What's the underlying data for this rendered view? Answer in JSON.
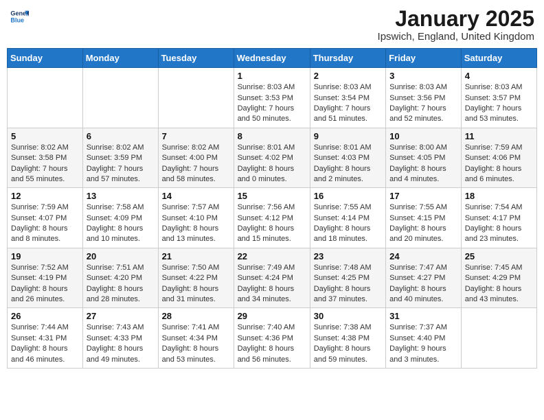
{
  "header": {
    "logo_line1": "General",
    "logo_line2": "Blue",
    "month_title": "January 2025",
    "location": "Ipswich, England, United Kingdom"
  },
  "weekdays": [
    "Sunday",
    "Monday",
    "Tuesday",
    "Wednesday",
    "Thursday",
    "Friday",
    "Saturday"
  ],
  "weeks": [
    [
      {
        "day": "",
        "info": ""
      },
      {
        "day": "",
        "info": ""
      },
      {
        "day": "",
        "info": ""
      },
      {
        "day": "1",
        "info": "Sunrise: 8:03 AM\nSunset: 3:53 PM\nDaylight: 7 hours\nand 50 minutes."
      },
      {
        "day": "2",
        "info": "Sunrise: 8:03 AM\nSunset: 3:54 PM\nDaylight: 7 hours\nand 51 minutes."
      },
      {
        "day": "3",
        "info": "Sunrise: 8:03 AM\nSunset: 3:56 PM\nDaylight: 7 hours\nand 52 minutes."
      },
      {
        "day": "4",
        "info": "Sunrise: 8:03 AM\nSunset: 3:57 PM\nDaylight: 7 hours\nand 53 minutes."
      }
    ],
    [
      {
        "day": "5",
        "info": "Sunrise: 8:02 AM\nSunset: 3:58 PM\nDaylight: 7 hours\nand 55 minutes."
      },
      {
        "day": "6",
        "info": "Sunrise: 8:02 AM\nSunset: 3:59 PM\nDaylight: 7 hours\nand 57 minutes."
      },
      {
        "day": "7",
        "info": "Sunrise: 8:02 AM\nSunset: 4:00 PM\nDaylight: 7 hours\nand 58 minutes."
      },
      {
        "day": "8",
        "info": "Sunrise: 8:01 AM\nSunset: 4:02 PM\nDaylight: 8 hours\nand 0 minutes."
      },
      {
        "day": "9",
        "info": "Sunrise: 8:01 AM\nSunset: 4:03 PM\nDaylight: 8 hours\nand 2 minutes."
      },
      {
        "day": "10",
        "info": "Sunrise: 8:00 AM\nSunset: 4:05 PM\nDaylight: 8 hours\nand 4 minutes."
      },
      {
        "day": "11",
        "info": "Sunrise: 7:59 AM\nSunset: 4:06 PM\nDaylight: 8 hours\nand 6 minutes."
      }
    ],
    [
      {
        "day": "12",
        "info": "Sunrise: 7:59 AM\nSunset: 4:07 PM\nDaylight: 8 hours\nand 8 minutes."
      },
      {
        "day": "13",
        "info": "Sunrise: 7:58 AM\nSunset: 4:09 PM\nDaylight: 8 hours\nand 10 minutes."
      },
      {
        "day": "14",
        "info": "Sunrise: 7:57 AM\nSunset: 4:10 PM\nDaylight: 8 hours\nand 13 minutes."
      },
      {
        "day": "15",
        "info": "Sunrise: 7:56 AM\nSunset: 4:12 PM\nDaylight: 8 hours\nand 15 minutes."
      },
      {
        "day": "16",
        "info": "Sunrise: 7:55 AM\nSunset: 4:14 PM\nDaylight: 8 hours\nand 18 minutes."
      },
      {
        "day": "17",
        "info": "Sunrise: 7:55 AM\nSunset: 4:15 PM\nDaylight: 8 hours\nand 20 minutes."
      },
      {
        "day": "18",
        "info": "Sunrise: 7:54 AM\nSunset: 4:17 PM\nDaylight: 8 hours\nand 23 minutes."
      }
    ],
    [
      {
        "day": "19",
        "info": "Sunrise: 7:52 AM\nSunset: 4:19 PM\nDaylight: 8 hours\nand 26 minutes."
      },
      {
        "day": "20",
        "info": "Sunrise: 7:51 AM\nSunset: 4:20 PM\nDaylight: 8 hours\nand 28 minutes."
      },
      {
        "day": "21",
        "info": "Sunrise: 7:50 AM\nSunset: 4:22 PM\nDaylight: 8 hours\nand 31 minutes."
      },
      {
        "day": "22",
        "info": "Sunrise: 7:49 AM\nSunset: 4:24 PM\nDaylight: 8 hours\nand 34 minutes."
      },
      {
        "day": "23",
        "info": "Sunrise: 7:48 AM\nSunset: 4:25 PM\nDaylight: 8 hours\nand 37 minutes."
      },
      {
        "day": "24",
        "info": "Sunrise: 7:47 AM\nSunset: 4:27 PM\nDaylight: 8 hours\nand 40 minutes."
      },
      {
        "day": "25",
        "info": "Sunrise: 7:45 AM\nSunset: 4:29 PM\nDaylight: 8 hours\nand 43 minutes."
      }
    ],
    [
      {
        "day": "26",
        "info": "Sunrise: 7:44 AM\nSunset: 4:31 PM\nDaylight: 8 hours\nand 46 minutes."
      },
      {
        "day": "27",
        "info": "Sunrise: 7:43 AM\nSunset: 4:33 PM\nDaylight: 8 hours\nand 49 minutes."
      },
      {
        "day": "28",
        "info": "Sunrise: 7:41 AM\nSunset: 4:34 PM\nDaylight: 8 hours\nand 53 minutes."
      },
      {
        "day": "29",
        "info": "Sunrise: 7:40 AM\nSunset: 4:36 PM\nDaylight: 8 hours\nand 56 minutes."
      },
      {
        "day": "30",
        "info": "Sunrise: 7:38 AM\nSunset: 4:38 PM\nDaylight: 8 hours\nand 59 minutes."
      },
      {
        "day": "31",
        "info": "Sunrise: 7:37 AM\nSunset: 4:40 PM\nDaylight: 9 hours\nand 3 minutes."
      },
      {
        "day": "",
        "info": ""
      }
    ]
  ]
}
